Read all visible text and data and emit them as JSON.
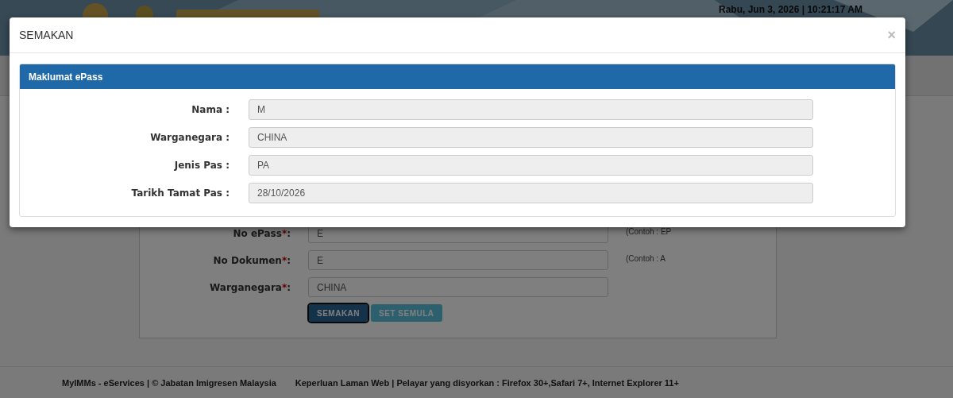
{
  "header": {
    "datetime": "Rabu, Jun 3, 2026 | 10:21:17 AM"
  },
  "form": {
    "fields": [
      {
        "label": "No ePass",
        "required_mark": "*",
        "colon": ":",
        "value": "E",
        "hint": "(Contoh : EP"
      },
      {
        "label": "No Dokumen",
        "required_mark": "*",
        "colon": ":",
        "value": "E",
        "hint": "(Contoh : A"
      },
      {
        "label": "Warganegara",
        "required_mark": "*",
        "colon": ":",
        "value": "CHINA"
      }
    ],
    "buttons": [
      {
        "label": "SEMAKAN",
        "kind": "primary",
        "selected": true
      },
      {
        "label": "SET SEMULA",
        "kind": "secondary",
        "selected": false
      }
    ]
  },
  "footer": {
    "left": "MyIMMs - eServices | © Jabatan Imigresen Malaysia",
    "right": "Keperluan Laman Web | Pelayar yang disyorkan : Firefox 30+,Safari 7+, Internet Explorer 11+"
  },
  "modal": {
    "title": "SEMAKAN",
    "close": "×",
    "panel_title": "Maklumat ePass",
    "fields": [
      {
        "label": "Nama :",
        "value": "M"
      },
      {
        "label": "Warganegara :",
        "value": "CHINA"
      },
      {
        "label": "Jenis Pas :",
        "value": "PA"
      },
      {
        "label": "Tarikh Tamat Pas :",
        "value": "28/10/2026"
      }
    ]
  }
}
